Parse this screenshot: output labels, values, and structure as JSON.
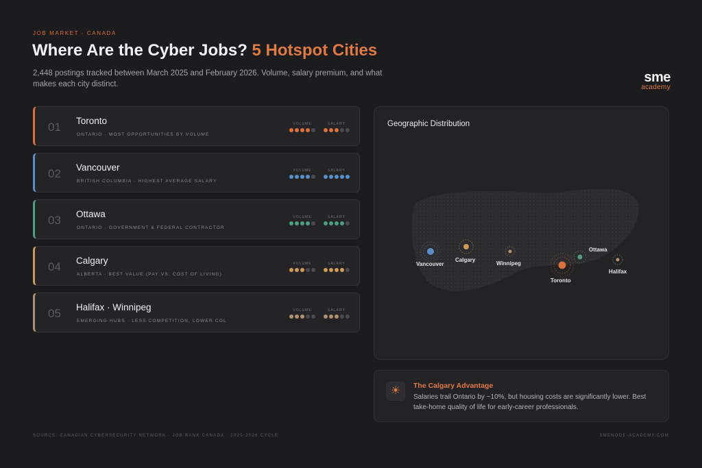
{
  "header": {
    "eyebrow": "Job Market · Canada",
    "title_main": "Where Are the Cyber Jobs?",
    "title_accent": "5 Hotspot Cities",
    "subtitle": "2,448 postings tracked between March 2025 and February 2026. Volume, salary premium, and what makes each city distinct."
  },
  "logo": {
    "top": "sme",
    "bottom": "academy"
  },
  "meter_labels": {
    "volume": "Volume",
    "salary": "Salary"
  },
  "cities": [
    {
      "num": "01",
      "name": "Toronto",
      "desc": "Ontario · Most opportunities by volume",
      "color": "#d9703e",
      "volume": 4,
      "salary": 3
    },
    {
      "num": "02",
      "name": "Vancouver",
      "desc": "British Columbia · Highest average salary",
      "color": "#5b8fc9",
      "volume": 4,
      "salary": 5
    },
    {
      "num": "03",
      "name": "Ottawa",
      "desc": "Ontario · Government & federal contractor",
      "color": "#4fa082",
      "volume": 4,
      "salary": 4
    },
    {
      "num": "04",
      "name": "Calgary",
      "desc": "Alberta · Best value (pay vs. cost of living)",
      "color": "#cc9a5a",
      "volume": 3,
      "salary": 4
    },
    {
      "num": "05",
      "name": "Halifax · Winnipeg",
      "desc": "Emerging hubs · Less competition, lower COL",
      "color": "#b09270",
      "volume": 3,
      "salary": 3
    }
  ],
  "map": {
    "title": "Geographic Distribution",
    "labels": {
      "vancouver": "Vancouver",
      "calgary": "Calgary",
      "winnipeg": "Winnipeg",
      "toronto": "Toronto",
      "ottawa": "Ottawa",
      "halifax": "Halifax"
    }
  },
  "tip": {
    "icon": "lightbulb-icon",
    "title": "The Calgary Advantage",
    "body": "Salaries trail Ontario by ~10%, but housing costs are significantly lower. Best take-home quality of life for early-career professionals."
  },
  "footer": {
    "source": "Source: Canadian Cybersecurity Network · Job Bank Canada · 2025-2026 cycle",
    "site": "smenode-academy.com"
  }
}
